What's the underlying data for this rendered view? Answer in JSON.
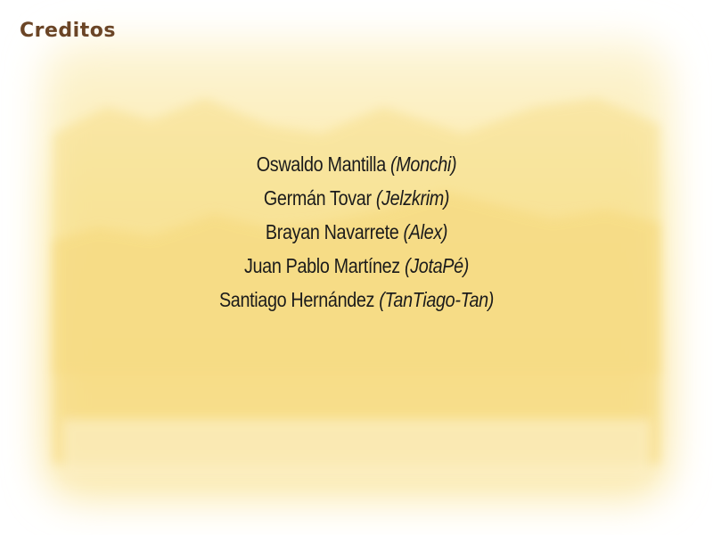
{
  "screen": {
    "title": "Creditos"
  },
  "credits": [
    {
      "name": "Oswaldo Mantilla",
      "alias": "(Monchi)"
    },
    {
      "name": "Germán Tovar",
      "alias": "(Jelzkrim)"
    },
    {
      "name": "Brayan Navarrete",
      "alias": "(Alex)"
    },
    {
      "name": "Juan Pablo Martínez",
      "alias": "(JotaPé)"
    },
    {
      "name": "Santiago Hernández",
      "alias": "(TanTiago-Tan)"
    }
  ],
  "colors": {
    "title": "#6b4526",
    "text": "#1b1b1b",
    "parchment_light": "#fdf3cf",
    "parchment_mid": "#fae9a6",
    "mountains": "#f6df8f"
  }
}
